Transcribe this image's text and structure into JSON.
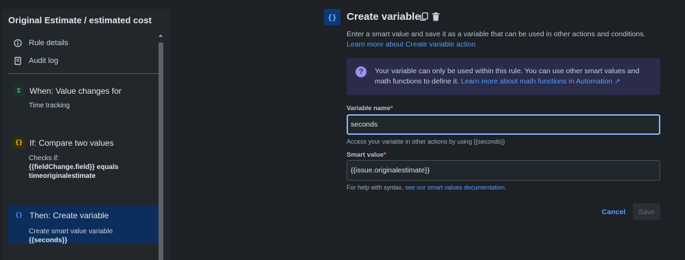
{
  "rule": {
    "title": "Original Estimate / estimated cost",
    "nav": [
      {
        "label": "Rule details",
        "icon": "info-icon"
      },
      {
        "label": "Audit log",
        "icon": "document-icon"
      }
    ],
    "steps": [
      {
        "title": "When: Value changes for",
        "body_line1": "Time tracking",
        "badge": "trigger-icon",
        "badge_glyph": "⌶",
        "color": "#4bce97"
      },
      {
        "title": "If: Compare two values",
        "body_prefix": "Checks if:",
        "body_bold1": "{{fieldChange.field}} equals",
        "body_bold2": "timeoriginalestimate",
        "badge": "condition-braces-icon",
        "badge_glyph": "{}",
        "color": "#f5cd47"
      },
      {
        "title": "Then: Create variable",
        "body_line1": "Create smart value variable",
        "body_bold": "{{seconds}}",
        "badge": "action-braces-icon",
        "badge_glyph": "{}",
        "color": "#579dff"
      }
    ]
  },
  "config": {
    "header_glyph": "{}",
    "title": "Create variable",
    "description": "Enter a smart value and save it as a variable that can be used in other actions and conditions.",
    "description_link": "Learn more about Create variable action",
    "info_text": "Your variable can only be used within this rule. You can use other smart values and math functions to define it.",
    "info_link": "Learn more about math functions in Automation ↗",
    "variable_name_label": "Variable name",
    "variable_name_value": "seconds",
    "variable_name_help": "Access your variable in other actions by using {{seconds}}",
    "smart_value_label": "Smart value",
    "smart_value_value": "{{issue.originalestimate}}",
    "smart_value_help": "For help with syntax,",
    "smart_value_help_link": "see our smart values documentation.",
    "required_mark": "*",
    "cancel_label": "Cancel",
    "save_label": "Save"
  },
  "colors": {
    "accent": "#579dff",
    "focus": "#85b8ff",
    "info_bg": "#2b2c4a",
    "selected_step": "#0c2e5c"
  }
}
